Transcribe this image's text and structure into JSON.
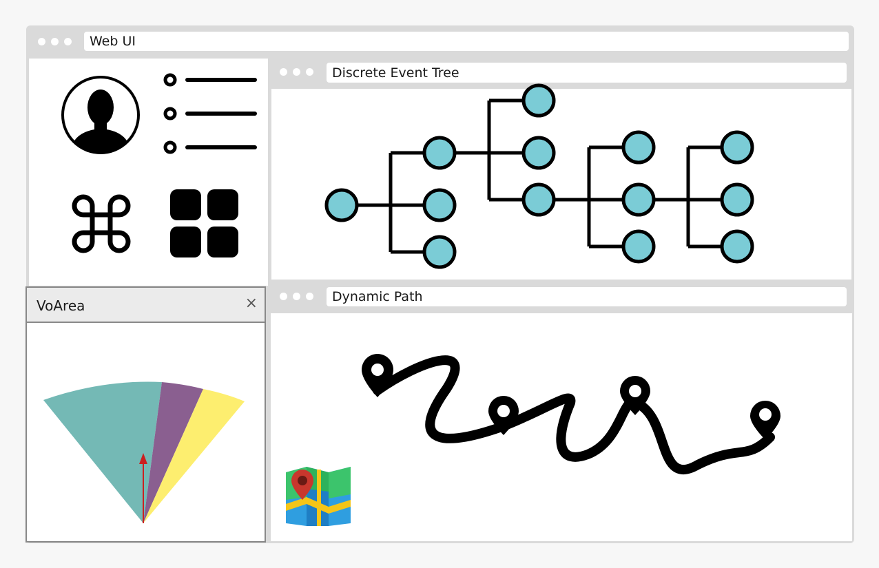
{
  "outer_window": {
    "title": "Web UI"
  },
  "tree_window": {
    "title": "Discrete Event Tree",
    "node_color": "#7bccd6"
  },
  "path_window": {
    "title": "Dynamic Path"
  },
  "voarea_window": {
    "title": "VoArea",
    "close_glyph": "×",
    "sector_colors": [
      "#74b9b5",
      "#8a5f90",
      "#fdee6f"
    ],
    "arrow_color": "#cc1f1f"
  },
  "icons": [
    "user-avatar-icon",
    "list-icon",
    "command-icon",
    "grid-icon",
    "map-icon",
    "location-pin-icon"
  ]
}
